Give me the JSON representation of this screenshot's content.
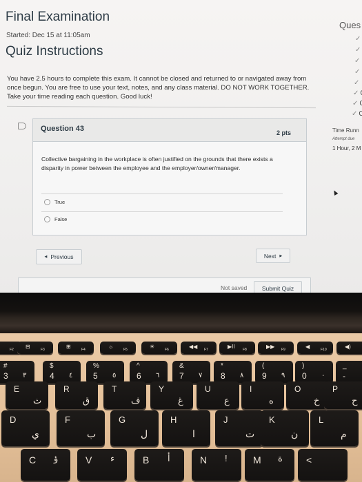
{
  "quiz": {
    "title": "Final Examination",
    "started": "Started: Dec 15 at 11:05am",
    "instructions_heading": "Quiz Instructions",
    "instructions": "You have 2.5 hours to complete this exam. It cannot be closed and returned to or navigated away from once begun. You are free to use your text, notes, and any class material. DO NOT WORK TOGETHER. Take your time reading each question. Good luck!"
  },
  "question": {
    "name": "Question 43",
    "points": "2 pts",
    "text": "Collective bargaining in the workplace is often justified on the grounds that there exists a disparity in power between the employee and the employer/owner/manager.",
    "answers": [
      {
        "label": "True",
        "selected": false
      },
      {
        "label": "False",
        "selected": false
      }
    ]
  },
  "navigation": {
    "previous_label": "Previous",
    "next_label": "Next",
    "save_status": "Not saved",
    "submit_label": "Submit Quiz"
  },
  "sidebar": {
    "title": "Ques",
    "checks": [
      "",
      "",
      "",
      "",
      "",
      "C",
      "C",
      "C"
    ],
    "timer_title": "Time Runn",
    "attempt_due": "Attempt due",
    "timer_value": "1 Hour, 2 M"
  },
  "keyboard": {
    "function_row": [
      {
        "primary": "F2",
        "icon": ""
      },
      {
        "primary": "F3",
        "icon": "⊟"
      },
      {
        "primary": "F4",
        "icon": "⊞"
      },
      {
        "primary": "F5",
        "icon": "☼"
      },
      {
        "primary": "F6",
        "icon": "☀"
      },
      {
        "primary": "F7",
        "icon": "◀◀"
      },
      {
        "primary": "F8",
        "icon": "▶II"
      },
      {
        "primary": "F9",
        "icon": "▶▶"
      },
      {
        "primary": "F10",
        "icon": "◀"
      },
      {
        "primary": "",
        "icon": "◀)"
      }
    ],
    "number_row": [
      {
        "top": "#",
        "main": "3",
        "alt": "٣"
      },
      {
        "top": "$",
        "main": "4",
        "alt": "٤"
      },
      {
        "top": "%",
        "main": "5",
        "alt": "٥"
      },
      {
        "top": "^",
        "main": "6",
        "alt": "٦"
      },
      {
        "top": "&",
        "main": "7",
        "alt": "٧"
      },
      {
        "top": "*",
        "main": "8",
        "alt": "٨"
      },
      {
        "top": "(",
        "main": "9",
        "alt": "٩"
      },
      {
        "top": ")",
        "main": "0",
        "alt": "٠"
      },
      {
        "top": "_",
        "main": "-",
        "alt": ""
      }
    ],
    "top_row": [
      {
        "main": "E",
        "alt": "ث"
      },
      {
        "main": "R",
        "alt": "ق"
      },
      {
        "main": "T",
        "alt": "ف"
      },
      {
        "main": "Y",
        "alt": "غ"
      },
      {
        "main": "U",
        "alt": "ع"
      },
      {
        "main": "I",
        "alt": "ه"
      },
      {
        "main": "O",
        "alt": "خ"
      },
      {
        "main": "P",
        "alt": "ح"
      }
    ],
    "home_row": [
      {
        "main": "D",
        "alt": "ي"
      },
      {
        "main": "F",
        "alt": "ب"
      },
      {
        "main": "G",
        "alt": "ل"
      },
      {
        "main": "H",
        "alt": "ا"
      },
      {
        "main": "J",
        "alt": "ت"
      },
      {
        "main": "K",
        "alt": "ن"
      },
      {
        "main": "L",
        "alt": "م"
      }
    ],
    "bottom_row": [
      {
        "main": "C",
        "alt": "ؤ"
      },
      {
        "main": "V",
        "alt": "ء"
      },
      {
        "main": "B",
        "alt": "أ"
      },
      {
        "main": "N",
        "alt": "!"
      },
      {
        "main": "M",
        "alt": "ة"
      },
      {
        "main": "<",
        "alt": ""
      }
    ]
  }
}
